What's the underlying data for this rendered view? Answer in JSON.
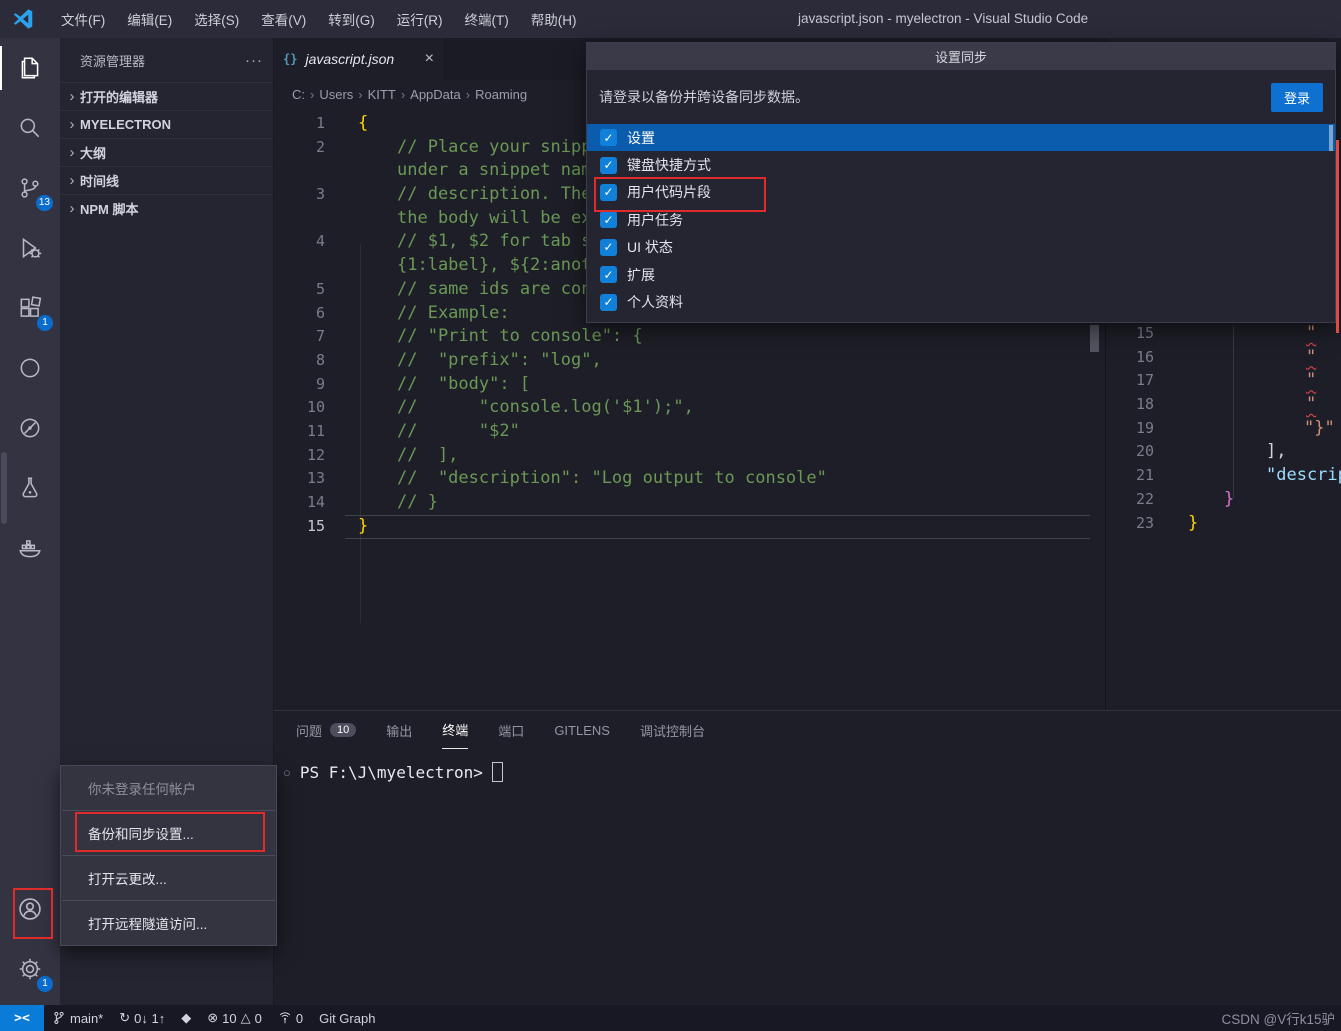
{
  "window": {
    "title": "javascript.json - myelectron - Visual Studio Code",
    "menus": [
      "文件(F)",
      "编辑(E)",
      "选择(S)",
      "查看(V)",
      "转到(G)",
      "运行(R)",
      "终端(T)",
      "帮助(H)"
    ]
  },
  "activity_bar": {
    "scm_badge": "13",
    "extensions_badge": "1",
    "settings_badge": "1"
  },
  "sidebar": {
    "title": "资源管理器",
    "sections": [
      {
        "label": "打开的编辑器"
      },
      {
        "label": "MYELECTRON"
      },
      {
        "label": "大纲"
      },
      {
        "label": "时间线"
      },
      {
        "label": "NPM 脚本"
      }
    ]
  },
  "editor": {
    "tab_label": "javascript.json",
    "breadcrumb": [
      "C:",
      "Users",
      "KITT",
      "AppData",
      "Roaming"
    ],
    "rows": [
      {
        "n": "1",
        "t": "{"
      },
      {
        "n": "2",
        "t": "// Place your snippets for javascript here. Each snippet is defined "
      },
      {
        "n": "",
        "t": "under a snippet name and has a prefix, body and "
      },
      {
        "n": "3",
        "t": "// description. The prefix is what is used to trigger the snippet and "
      },
      {
        "n": "",
        "t": "the body will be expanded and inserted. Possible variables are:"
      },
      {
        "n": "4",
        "t": "// $1, $2 for tab stops, $0 for the final cursor position, and $"
      },
      {
        "n": "",
        "t": "{1:label}, ${2:another} for placeholders. Placeholders with the "
      },
      {
        "n": "5",
        "t": "// same ids are connected."
      },
      {
        "n": "6",
        "t": "// Example:"
      },
      {
        "n": "7",
        "t": "// \"Print to console\": {"
      },
      {
        "n": "8",
        "t": "//  \"prefix\": \"log\","
      },
      {
        "n": "9",
        "t": "//  \"body\": ["
      },
      {
        "n": "10",
        "t": "//      \"console.log('$1');\","
      },
      {
        "n": "11",
        "t": "//      \"$2\""
      },
      {
        "n": "12",
        "t": "//  ],"
      },
      {
        "n": "13",
        "t": "//  \"description\": \"Log output to console\""
      },
      {
        "n": "14",
        "t": "// }"
      },
      {
        "n": "15",
        "t": "}"
      }
    ]
  },
  "right_editor": {
    "rows": [
      {
        "n": "15",
        "t": "\""
      },
      {
        "n": "16",
        "t": "\""
      },
      {
        "n": "17",
        "t": "\""
      },
      {
        "n": "18",
        "t": "\""
      },
      {
        "n": "19",
        "t": "\"}\""
      },
      {
        "n": "20",
        "t": "],"
      },
      {
        "n": "21",
        "t": "\"descrip"
      },
      {
        "n": "22",
        "t": "}"
      },
      {
        "n": "23",
        "t": "}"
      }
    ]
  },
  "sync_dialog": {
    "title": "设置同步",
    "message": "请登录以备份并跨设备同步数据。",
    "login_label": "登录",
    "items": [
      {
        "label": "设置"
      },
      {
        "label": "键盘快捷方式"
      },
      {
        "label": "用户代码片段"
      },
      {
        "label": "用户任务"
      },
      {
        "label": "UI 状态"
      },
      {
        "label": "扩展"
      },
      {
        "label": "个人资料"
      }
    ]
  },
  "panel": {
    "tabs": [
      {
        "label": "问题",
        "badge": "10"
      },
      {
        "label": "输出"
      },
      {
        "label": "终端"
      },
      {
        "label": "端口"
      },
      {
        "label": "GITLENS"
      },
      {
        "label": "调试控制台"
      }
    ],
    "terminal_prompt": "PS F:\\J\\myelectron>"
  },
  "account_menu": {
    "items": [
      {
        "label": "你未登录任何帐户"
      },
      {
        "label": "备份和同步设置..."
      },
      {
        "label": "打开云更改..."
      },
      {
        "label": "打开远程隧道访问..."
      }
    ]
  },
  "status_bar": {
    "branch": "main*",
    "sync_counts": "0↓ 1↑",
    "errors": "10",
    "warnings": "0",
    "ports": "0",
    "git_graph": "Git Graph",
    "watermark": "CSDN @V行k15驴"
  },
  "colors": {
    "accent_blue": "#0e70d1",
    "selection_blue": "#0b5cad",
    "annotation_red": "#e02b2b",
    "error_red": "#f14c4c"
  }
}
